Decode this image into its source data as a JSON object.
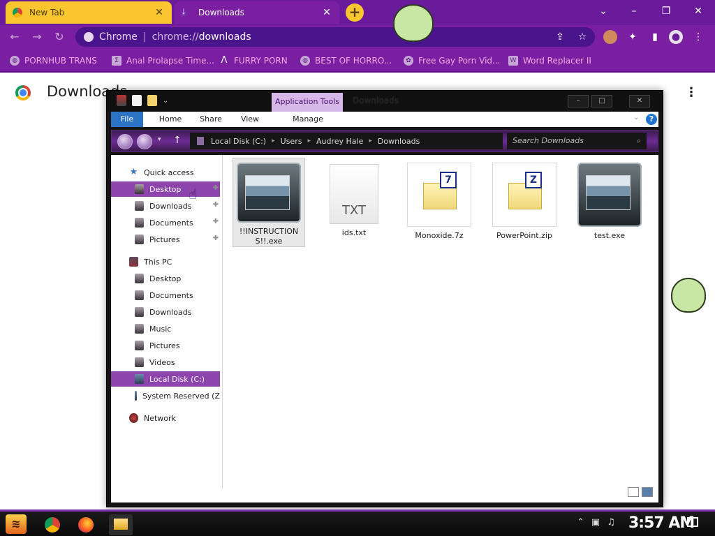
{
  "browser": {
    "tabs": [
      {
        "title": "New Tab",
        "active": false
      },
      {
        "title": "Downloads",
        "active": true
      }
    ],
    "omnibox": {
      "chip": "Chrome",
      "scheme": "chrome://",
      "host": "downloads"
    },
    "bookmarks": [
      {
        "label": "PORNHUB TRANS",
        "icon": "globe-icon"
      },
      {
        "label": "Anal Prolapse Time...",
        "icon": "bookmark-icon"
      },
      {
        "label": "FURRY PORN",
        "icon": "lambda-icon"
      },
      {
        "label": "BEST OF HORRO...",
        "icon": "globe-icon"
      },
      {
        "label": "Free Gay Porn Vid...",
        "icon": "site-icon"
      },
      {
        "label": "Word Replacer II",
        "icon": "extension-icon"
      }
    ],
    "colors": {
      "frame": "#7b1fa2",
      "new_tab": "#f9c62f",
      "bookmark_text": "#f3a8e8"
    }
  },
  "page": {
    "title": "Downloads"
  },
  "explorer": {
    "title": "Downloads",
    "context_tab": "Application Tools",
    "ribbon_tabs": [
      "File",
      "Home",
      "Share",
      "View",
      "Manage"
    ],
    "breadcrumb": [
      "Local Disk (C:)",
      "Users",
      "Audrey Hale",
      "Downloads"
    ],
    "search_placeholder": "Search Downloads",
    "nav": {
      "quick_access": "Quick access",
      "quick_items": [
        "Desktop",
        "Downloads",
        "Documents",
        "Pictures"
      ],
      "this_pc": "This PC",
      "pc_items": [
        "Desktop",
        "Documents",
        "Downloads",
        "Music",
        "Pictures",
        "Videos",
        "Local Disk (C:)",
        "System Reserved (Z"
      ],
      "network": "Network",
      "selected": [
        "Desktop",
        "Local Disk (C:)"
      ]
    },
    "files": [
      {
        "name": "!!INSTRUCTIONS!!.exe",
        "type": "exe",
        "selected": true
      },
      {
        "name": "ids.txt",
        "type": "txt",
        "badge": "TXT"
      },
      {
        "name": "Monoxide.7z",
        "type": "archive",
        "badge": "7"
      },
      {
        "name": "PowerPoint.zip",
        "type": "archive",
        "badge": "Z"
      },
      {
        "name": "test.exe",
        "type": "exe"
      }
    ]
  },
  "taskbar": {
    "apps": [
      "start-icon",
      "chrome-icon",
      "firefox-icon",
      "file-explorer-icon"
    ],
    "clock": "3:57 AM"
  }
}
